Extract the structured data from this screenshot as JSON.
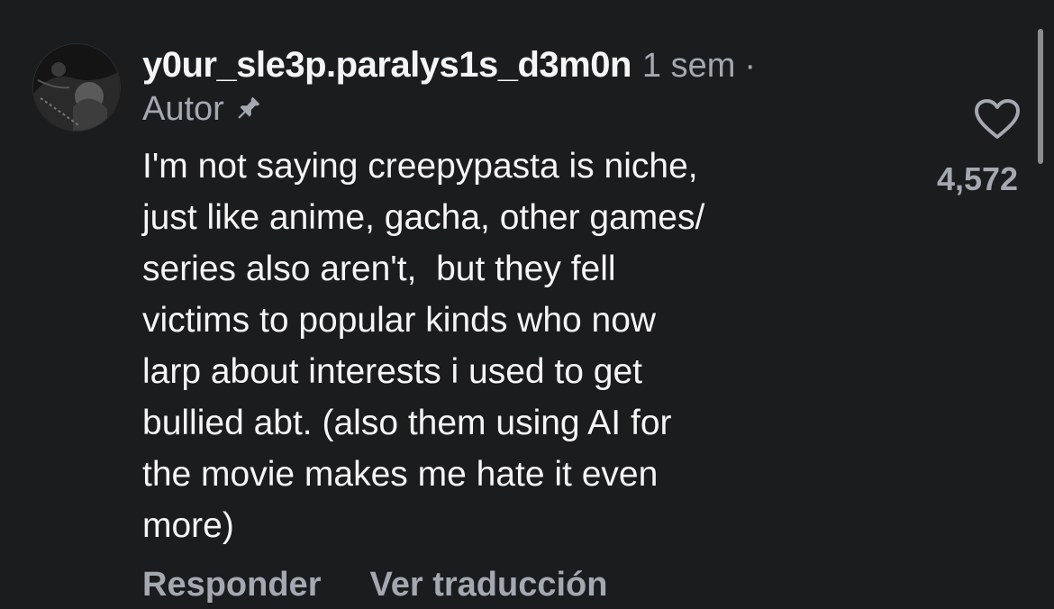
{
  "comment": {
    "username": "y0ur_sle3p.paralys1s_d3m0n",
    "timestamp": "1 sem",
    "separator": "·",
    "author_label": "Autor",
    "body_lines": [
      "I'm not saying creepypasta is niche,",
      "just like anime, gacha, other games/",
      "series also aren't,  but they fell",
      "victims to popular kinds who now",
      "larp about interests i used to get",
      "bullied abt. (also them using AI for",
      "the movie makes me hate it even",
      "more)"
    ],
    "likes": "4,572",
    "actions": {
      "reply": "Responder",
      "translate": "Ver traducción"
    }
  },
  "icons": {
    "like": "heart-icon",
    "pinned": "pin-icon"
  },
  "colors": {
    "background": "#1b1c1e",
    "primary_text": "#f5f5f5",
    "secondary_text": "#a3a8b1"
  }
}
